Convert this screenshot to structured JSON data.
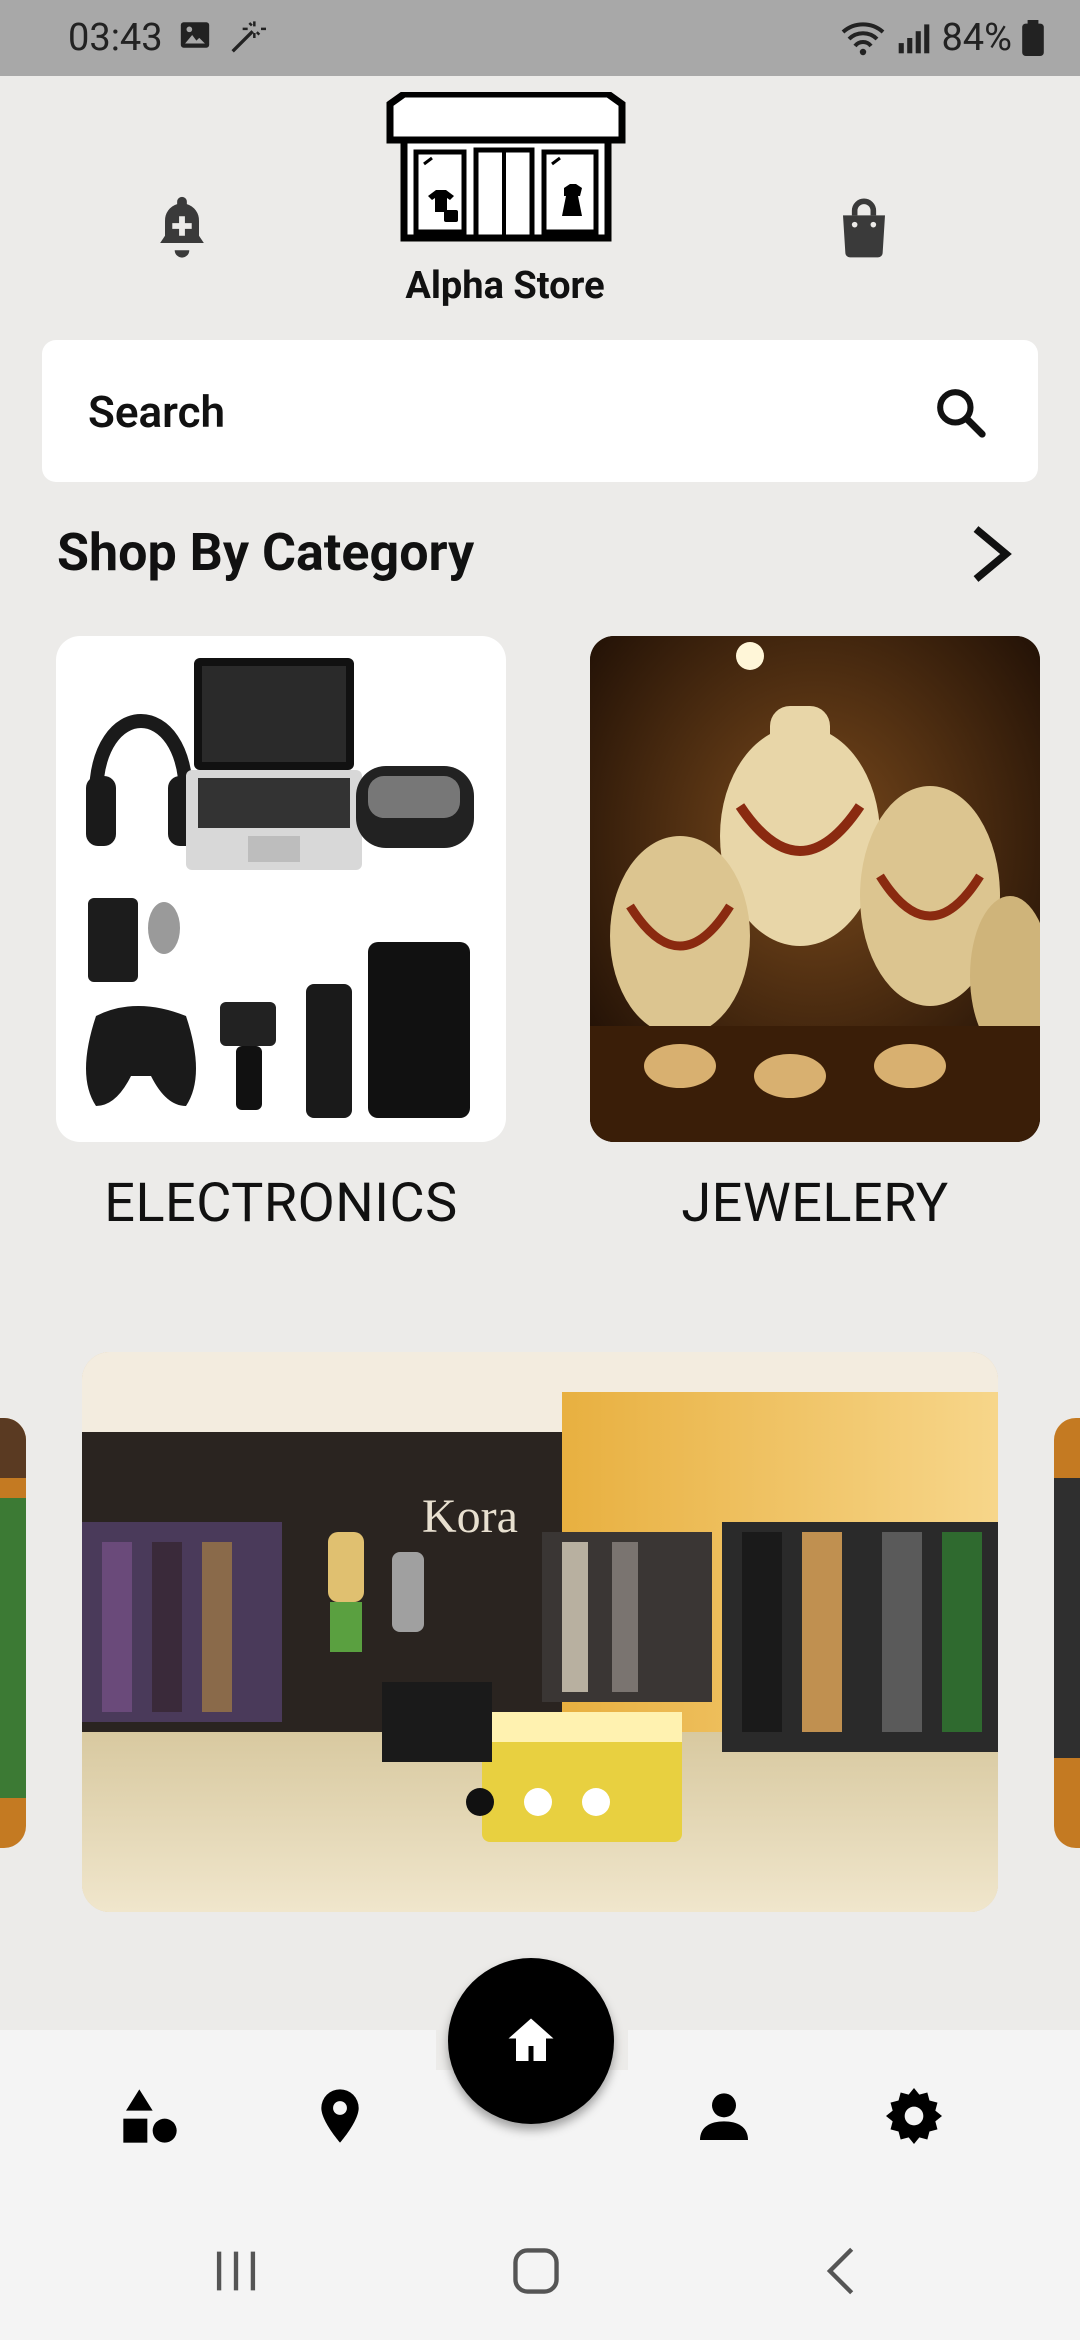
{
  "status_bar": {
    "time": "03:43",
    "battery": "84%",
    "icons_left": [
      "gallery-icon",
      "magic-wand-icon"
    ],
    "icons_right": [
      "wifi-icon",
      "signal-icon",
      "battery-icon"
    ]
  },
  "header": {
    "store_name": "Alpha Store",
    "left_icon": "notification-add-icon",
    "right_icon": "shopping-bag-icon"
  },
  "search": {
    "placeholder": "Search",
    "icon": "search-icon"
  },
  "categories": {
    "title": "Shop By Category",
    "items": [
      {
        "label": "ELECTRONICS"
      },
      {
        "label": "JEWELERY"
      }
    ]
  },
  "banner": {
    "storefront_sign": "Kora",
    "dots": 3,
    "active_dot": 0,
    "colors": {
      "active": "#111111",
      "inactive": "#ffffff"
    }
  },
  "bottom_nav": {
    "items": [
      "categories-icon",
      "location-icon",
      "home-icon",
      "profile-icon",
      "settings-icon"
    ],
    "active": "home-icon"
  },
  "system_nav": [
    "recents-icon",
    "home-circle-icon",
    "back-icon"
  ]
}
